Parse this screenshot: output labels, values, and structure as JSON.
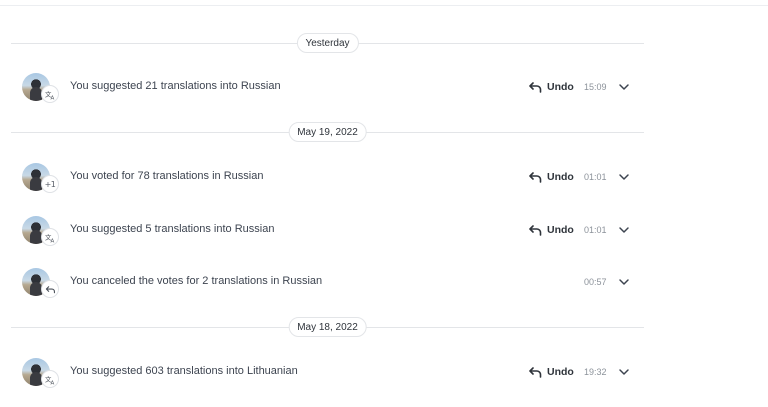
{
  "groups": [
    {
      "date": "Yesterday",
      "items": [
        {
          "text": "You suggested 21 translations into Russian",
          "badge_icon": "translate-icon",
          "undo": "Undo",
          "time": "15:09"
        }
      ]
    },
    {
      "date": "May 19, 2022",
      "items": [
        {
          "text": "You voted for 78 translations in Russian",
          "badge_icon": "vote-plus-icon",
          "badge_text": "+1",
          "undo": "Undo",
          "time": "01:01"
        },
        {
          "text": "You suggested 5 translations into Russian",
          "badge_icon": "translate-icon",
          "undo": "Undo",
          "time": "01:01"
        },
        {
          "text": "You canceled the votes for 2 translations in Russian",
          "badge_icon": "undo-icon",
          "time": "00:57"
        }
      ]
    },
    {
      "date": "May 18, 2022",
      "items": [
        {
          "text": "You suggested 603 translations into Lithuanian",
          "badge_icon": "translate-icon",
          "undo": "Undo",
          "time": "19:32"
        }
      ]
    }
  ]
}
